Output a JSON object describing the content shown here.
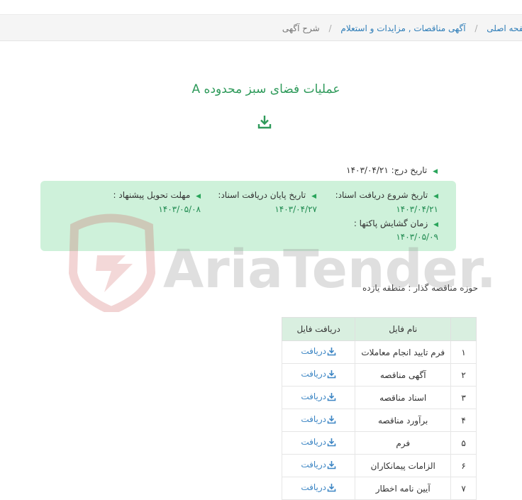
{
  "breadcrumb": {
    "home": "صفحه اصلی",
    "section": "آگهی مناقصات , مزایدات و استعلام",
    "current": "شرح آگهی"
  },
  "title": "عملیات فضای سبز محدوده A",
  "meta": {
    "insert_date_label": "تاریخ درج:",
    "insert_date": "۱۴۰۳/۰۴/۲۱"
  },
  "dates": {
    "receive_start_label": "تاریخ شروع دریافت اسناد:",
    "receive_start": "۱۴۰۳/۰۴/۲۱",
    "receive_end_label": "تاریخ پایان دریافت اسناد:",
    "receive_end": "۱۴۰۳/۰۴/۲۷",
    "deadline_label": "مهلت تحویل پیشنهاد :",
    "deadline": "۱۴۰۳/۰۵/۰۸",
    "opening_label": "زمان گشایش پاکتها :",
    "opening": "۱۴۰۳/۰۵/۰۹"
  },
  "watermark": "AriaTender.neT",
  "organizer": "حوزه مناقصه گذار : منطقه یازده",
  "table": {
    "headers": [
      "",
      "نام فایل",
      "دریافت فایل"
    ],
    "rows": [
      {
        "idx": "۱",
        "name": "فرم تایید انجام معاملات",
        "link": "دریافت"
      },
      {
        "idx": "۲",
        "name": "آگهی مناقصه",
        "link": "دریافت"
      },
      {
        "idx": "۳",
        "name": "اسناد مناقصه",
        "link": "دریافت"
      },
      {
        "idx": "۴",
        "name": "برآورد مناقصه",
        "link": "دریافت"
      },
      {
        "idx": "۵",
        "name": "فرم",
        "link": "دریافت"
      },
      {
        "idx": "۶",
        "name": "الزامات پیمانکاران",
        "link": "دریافت"
      },
      {
        "idx": "۷",
        "name": "آیین نامه اخطار",
        "link": "دریافت"
      }
    ]
  },
  "colors": {
    "accent_green": "#2e9a5a",
    "link_blue": "#2e7db8",
    "box_green": "#b0e8c4"
  },
  "icons": {
    "download": "download-icon",
    "bullet": "triangle-left-icon"
  }
}
